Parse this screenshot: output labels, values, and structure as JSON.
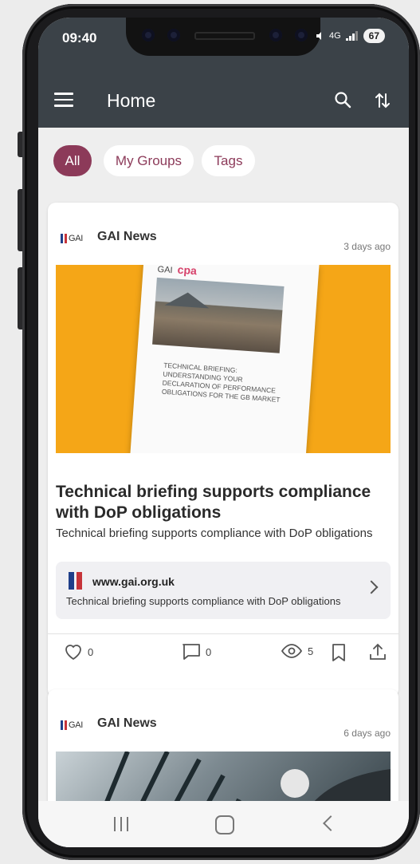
{
  "status_bar": {
    "time": "09:40",
    "network": "4G",
    "battery": "67"
  },
  "app_bar": {
    "title": "Home"
  },
  "filters": [
    {
      "label": "All",
      "active": true
    },
    {
      "label": "My Groups",
      "active": false
    },
    {
      "label": "Tags",
      "active": false
    }
  ],
  "posts": [
    {
      "source_logo_text": "GAI",
      "source": "GAI News",
      "time_ago": "3 days ago",
      "image_brand": "GAI",
      "image_brand_2": "cpa",
      "image_title": "TECHNICAL BRIEFING: UNDERSTANDING YOUR DECLARATION OF PERFORMANCE OBLIGATIONS FOR THE GB MARKET",
      "headline": "Technical briefing supports compliance with DoP obligations",
      "summary": "Technical briefing supports compliance with DoP obligations",
      "link": {
        "domain": "www.gai.org.uk",
        "description": "Technical briefing supports compliance with DoP obligations"
      },
      "likes": "0",
      "comments": "0",
      "views": "5"
    },
    {
      "source_logo_text": "GAI",
      "source": "GAI News",
      "time_ago": "6 days ago"
    }
  ],
  "colors": {
    "accent": "#8c3a59",
    "appbar": "#3b4248",
    "hero": "#f5a617"
  }
}
